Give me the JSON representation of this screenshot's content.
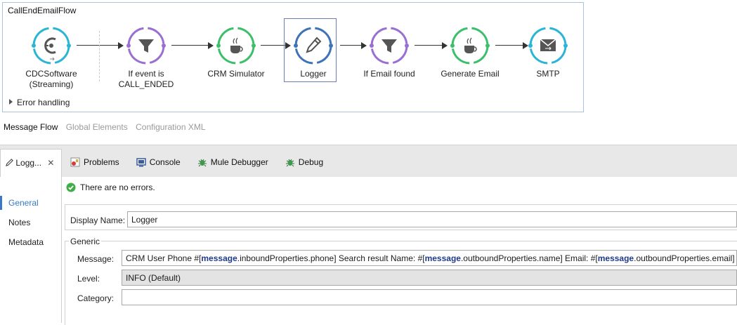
{
  "flow": {
    "title": "CallEndEmailFlow",
    "error_handling": "Error handling",
    "nodes": [
      {
        "id": "cdc",
        "label_line1": "CDCSoftware",
        "label_line2": "(Streaming)",
        "icon": "connector-c-icon",
        "color": "#2bb5d5"
      },
      {
        "id": "filter1",
        "label_line1": "If event is",
        "label_line2": "CALL_ENDED",
        "icon": "filter-funnel-icon",
        "color": "#9a6fd4"
      },
      {
        "id": "crm",
        "label_line1": "CRM Simulator",
        "label_line2": "",
        "icon": "java-cup-icon",
        "color": "#3cbf6a"
      },
      {
        "id": "logger",
        "label_line1": "Logger",
        "label_line2": "",
        "icon": "pencil-icon",
        "color": "#3e73b8"
      },
      {
        "id": "filter2",
        "label_line1": "If Email found",
        "label_line2": "",
        "icon": "filter-funnel-icon",
        "color": "#9a6fd4"
      },
      {
        "id": "genemail",
        "label_line1": "Generate Email",
        "label_line2": "",
        "icon": "java-cup-icon",
        "color": "#3cbf6a"
      },
      {
        "id": "smtp",
        "label_line1": "SMTP",
        "label_line2": "",
        "icon": "envelope-icon",
        "color": "#2bb5d5"
      }
    ]
  },
  "editor_tabs": {
    "message_flow": "Message Flow",
    "global_elements": "Global Elements",
    "configuration_xml": "Configuration XML"
  },
  "panel": {
    "logger_tab": "Logg...",
    "close": "✕",
    "tabs": {
      "problems": "Problems",
      "console": "Console",
      "mule_debugger": "Mule Debugger",
      "debug": "Debug"
    },
    "status": "There are no errors.",
    "side_nav": {
      "general": "General",
      "notes": "Notes",
      "metadata": "Metadata"
    },
    "display_name_label": "Display Name:",
    "display_name_value": "Logger",
    "generic_title": "Generic",
    "message_label": "Message:",
    "message_parts": {
      "p1": "CRM User Phone #[",
      "k1": "message",
      "p2": ".inboundProperties.phone] Search result Name: #[",
      "k2": "message",
      "p3": ".outboundProperties.name] Email: #[",
      "k3": "message",
      "p4": ".outboundProperties.email]"
    },
    "level_label": "Level:",
    "level_value": "INFO (Default)",
    "category_label": "Category:",
    "category_value": ""
  }
}
